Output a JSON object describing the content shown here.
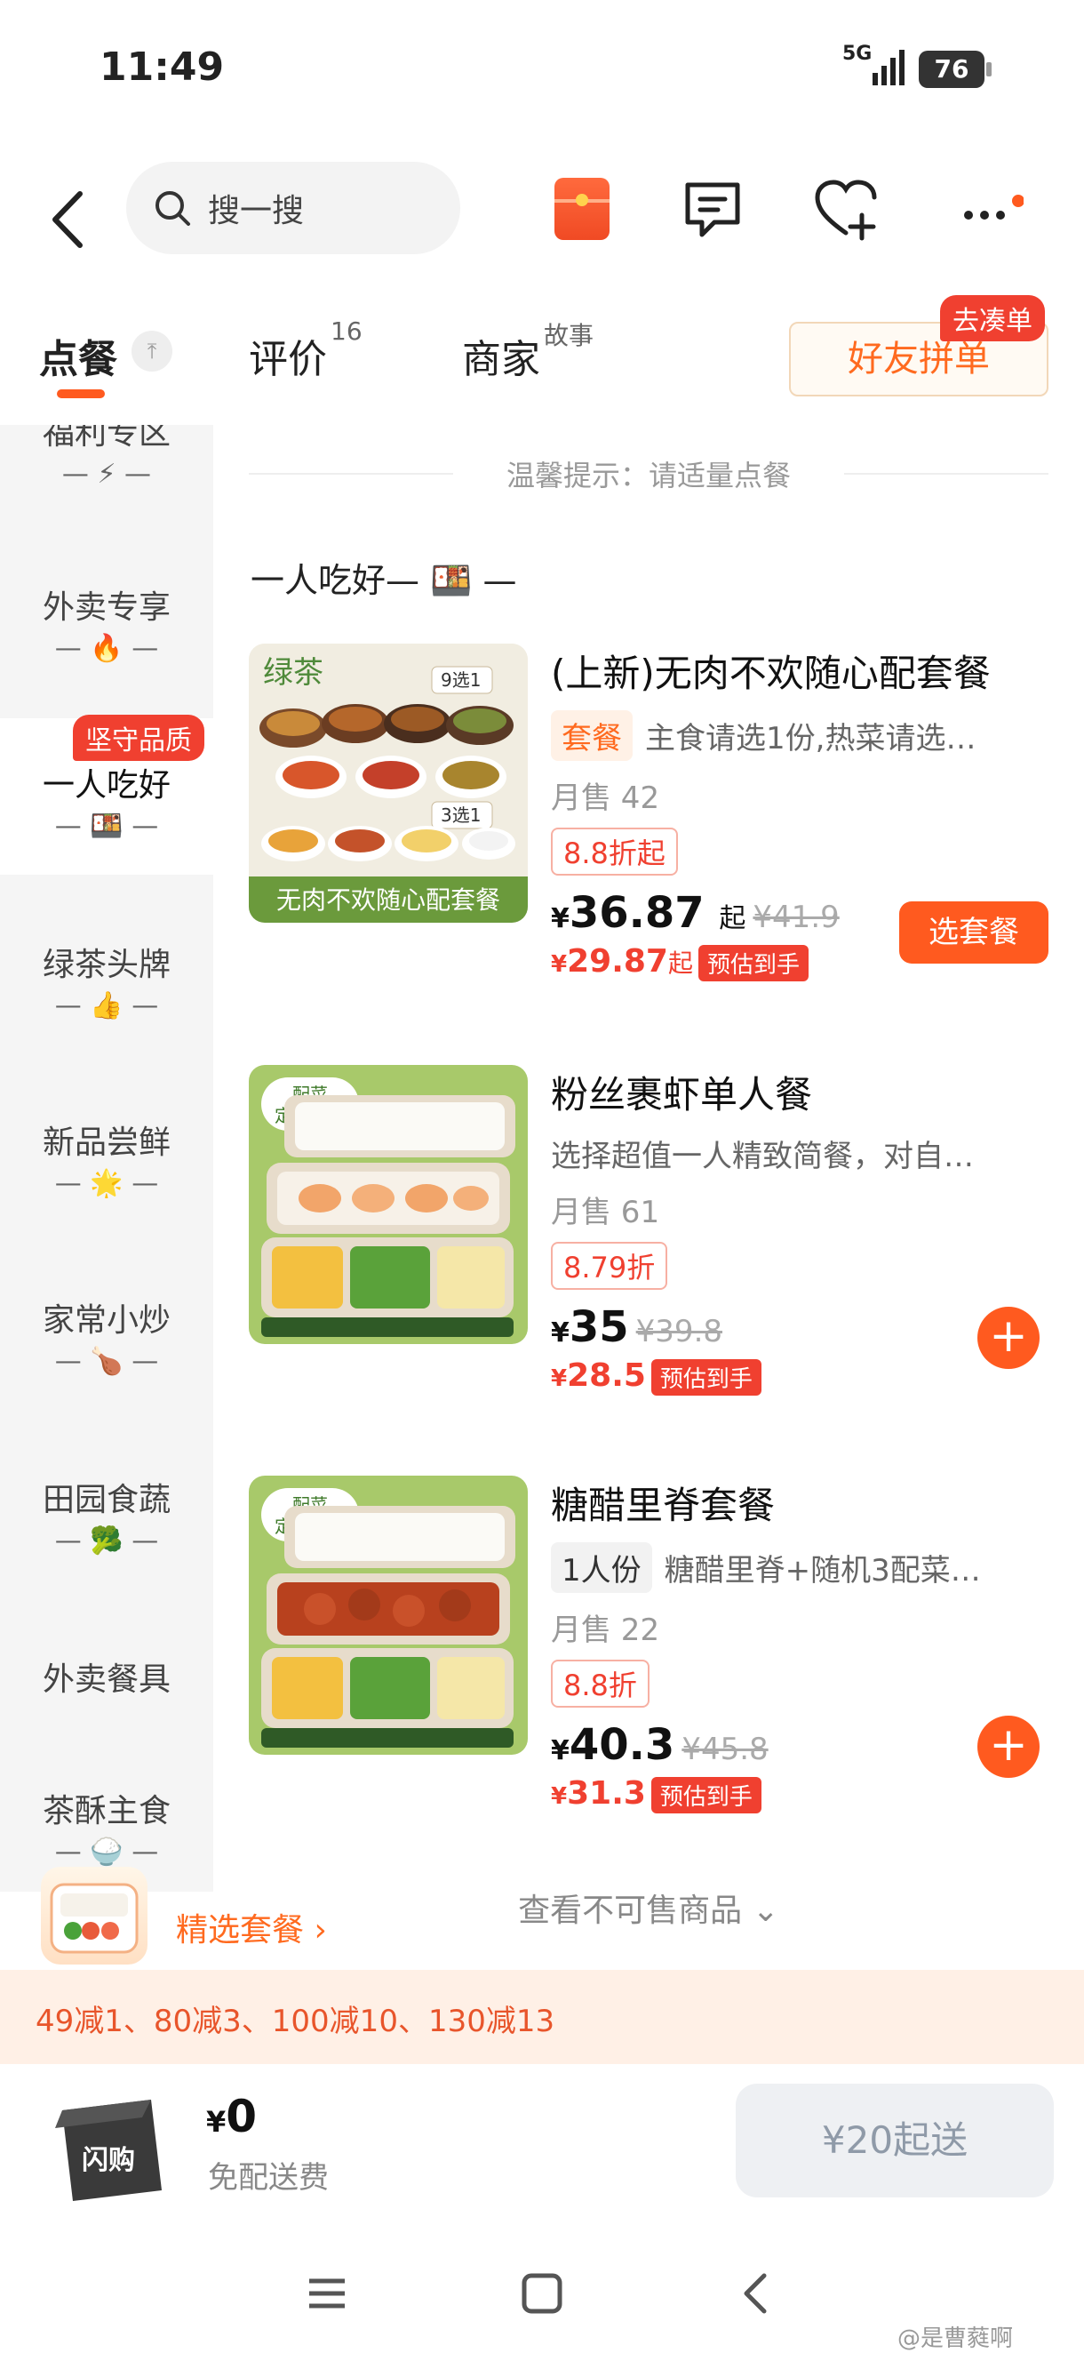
{
  "status": {
    "time": "11:49",
    "network": "5G",
    "battery": "76"
  },
  "search": {
    "placeholder": "搜一搜"
  },
  "tabs": {
    "order": "点餐",
    "reviews": "评价",
    "reviews_count": "16",
    "merchant": "商家",
    "merchant_sup": "故事",
    "group_button": "好友拼单",
    "group_badge": "去凑单"
  },
  "sidebar": {
    "items": [
      {
        "name": "福利专区",
        "emoji": "—  ⚡  —"
      },
      {
        "name": "外卖专享",
        "emoji": "—  🔥  —"
      },
      {
        "name": "一人吃好",
        "emoji": "—  🍱  —",
        "badge": "坚守品质"
      },
      {
        "name": "绿茶头牌",
        "emoji": "—  👍  —"
      },
      {
        "name": "新品尝鲜",
        "emoji": "—  🌟  —"
      },
      {
        "name": "家常小炒",
        "emoji": "—  🍗  —"
      },
      {
        "name": "田园食蔬",
        "emoji": "—  🥦  —"
      },
      {
        "name": "外卖餐具",
        "emoji": ""
      },
      {
        "name": "茶酥主食",
        "emoji": "—  🍚  —"
      }
    ]
  },
  "tip": "温馨提示：请适量点餐",
  "section_title": "一人吃好— 🍱 —",
  "items": [
    {
      "title": "(上新)无肉不欢随心配套餐",
      "tag": "套餐",
      "desc": "主食请选1份,热菜请选…",
      "sold": "月售 42",
      "discount": "8.8折起",
      "price": "36.87",
      "price_suffix": "起",
      "orig": "¥41.9",
      "est": "29.87",
      "est_suffix": "起",
      "est_badge": "预估到手",
      "button": "选套餐",
      "img_brand": "绿茶",
      "img_sub1": "9选1",
      "img_sub2": "3选1",
      "img_caption": "无肉不欢随心配套餐"
    },
    {
      "title": "粉丝裹虾单人餐",
      "desc": "选择超值一人精致简餐，对自…",
      "sold": "月售 61",
      "discount": "8.79折",
      "price": "35",
      "orig": "¥39.8",
      "est": "28.5",
      "est_badge": "预估到手",
      "img_badge": "配菜\n定期调整"
    },
    {
      "title": "糖醋里脊套餐",
      "tag": "1人份",
      "desc": "糖醋里脊+随机3配菜…",
      "sold": "月售 22",
      "discount": "8.8折",
      "price": "40.3",
      "orig": "¥45.8",
      "est": "31.3",
      "est_badge": "预估到手",
      "img_badge": "配菜\n定期调整"
    }
  ],
  "more_link": "查看不可售商品",
  "promo": {
    "label": "精选套餐 ›"
  },
  "coupons": "49减1、80减3、100减10、130减13",
  "cart": {
    "yen": "¥",
    "price": "0",
    "fee": "免配送费",
    "bag_text": "闪购",
    "min_button": "¥20起送"
  },
  "yen": "¥",
  "watermark": "@是曹蕤啊",
  "colors": {
    "accent": "#ff5a1f",
    "red": "#f04030"
  }
}
